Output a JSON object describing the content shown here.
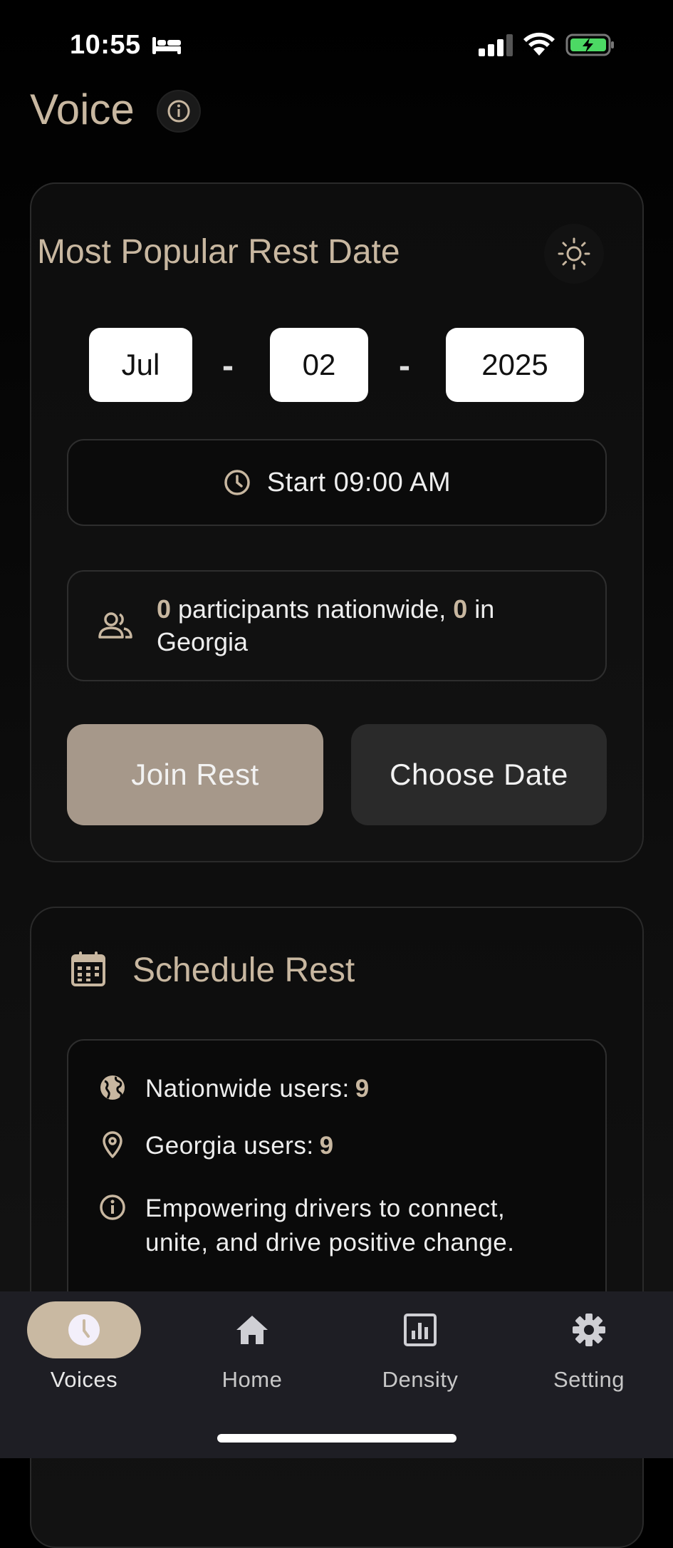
{
  "status_bar": {
    "time": "10:55"
  },
  "header": {
    "title": "Voice"
  },
  "popular": {
    "title": "Most Popular Rest Date",
    "month": "Jul",
    "day": "02",
    "year": "2025",
    "separator": "-",
    "start_text": "Start 09:00 AM",
    "participants_nationwide": "0",
    "participants_text_1": " participants nationwide, ",
    "participants_state": "0",
    "participants_text_2": " in Georgia",
    "join_button": "Join Rest",
    "choose_button": "Choose Date"
  },
  "schedule": {
    "title": "Schedule Rest",
    "nationwide_label": "Nationwide users:",
    "nationwide_value": "9",
    "state_label": "Georgia users:",
    "state_value": "9",
    "info_text": "Empowering drivers to connect, unite, and drive positive change."
  },
  "nav": {
    "items": [
      {
        "label": "Voices",
        "icon": "clock-icon",
        "active": true
      },
      {
        "label": "Home",
        "icon": "home-icon"
      },
      {
        "label": "Density",
        "icon": "chart-icon"
      },
      {
        "label": "Setting",
        "icon": "gear-icon"
      }
    ]
  },
  "colors": {
    "accent": "#c8b7a0",
    "join_button": "#a6988a",
    "choose_button": "#2a2a2a",
    "nav_background": "#1e1e24",
    "battery": "#4cd964"
  }
}
